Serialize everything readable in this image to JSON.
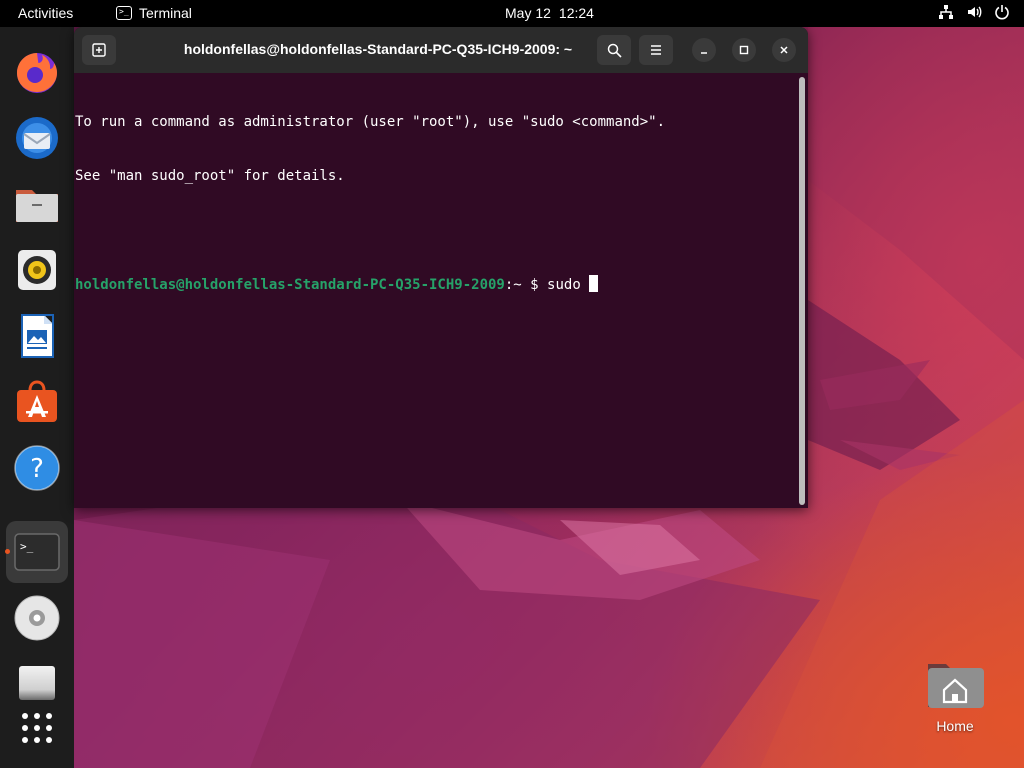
{
  "topbar": {
    "activities": "Activities",
    "app_name": "Terminal",
    "app_icon_glyph": ">_",
    "date": "May 12",
    "time": "12:24",
    "tray_icons": [
      "network-icon",
      "volume-icon",
      "power-icon"
    ]
  },
  "dock": {
    "items": [
      {
        "name": "firefox",
        "icon": "firefox-icon"
      },
      {
        "name": "thunderbird",
        "icon": "thunderbird-icon"
      },
      {
        "name": "files",
        "icon": "files-icon"
      },
      {
        "name": "rhythmbox",
        "icon": "rhythmbox-icon"
      },
      {
        "name": "libreoffice-writer",
        "icon": "writer-icon"
      },
      {
        "name": "ubuntu-software",
        "icon": "software-icon"
      },
      {
        "name": "help",
        "icon": "help-icon"
      },
      {
        "name": "terminal",
        "icon": "terminal-icon",
        "active": true
      },
      {
        "name": "disc",
        "icon": "cd-icon"
      },
      {
        "name": "trash",
        "icon": "drive-icon"
      },
      {
        "name": "show-apps",
        "icon": "app-grid-icon"
      }
    ],
    "terminal_glyph": ">_",
    "help_glyph": "?"
  },
  "terminal": {
    "title": "holdonfellas@holdonfellas-Standard-PC-Q35-ICH9-2009: ~",
    "lines": [
      "To run a command as administrator (user \"root\"), use \"sudo <command>\".",
      "See \"man sudo_root\" for details."
    ],
    "prompt_user": "holdonfellas@holdonfellas-Standard-PC-Q35-ICH9-2009",
    "prompt_path": ":~",
    "prompt_symbol": "$",
    "command": "sudo "
  },
  "desktop": {
    "home_label": "Home"
  },
  "colors": {
    "accent": "#e95420",
    "terminal_bg": "#300a24",
    "prompt_green": "#26a269",
    "header_bg": "#2b2b2b"
  }
}
